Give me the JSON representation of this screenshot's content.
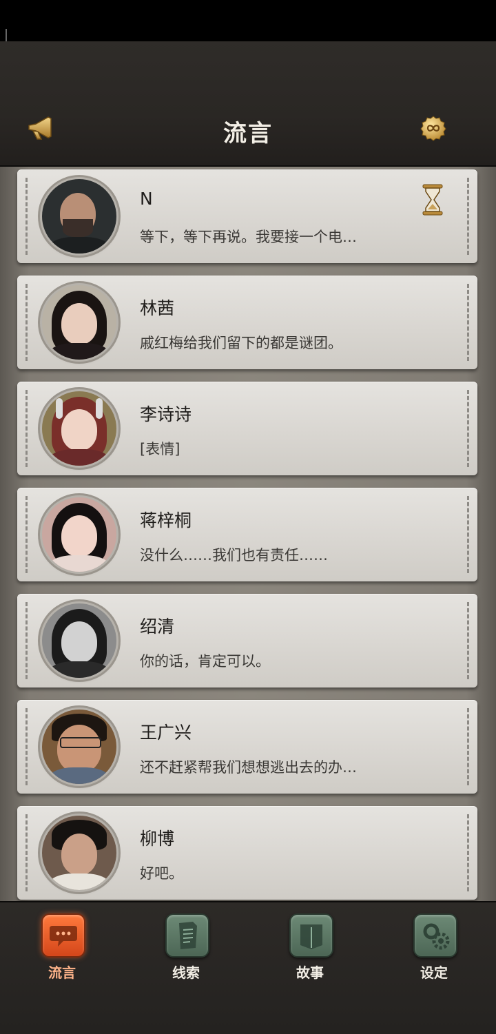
{
  "header": {
    "title": "流言",
    "left_icon": "megaphone-icon",
    "right_icon": "infinity-badge-icon"
  },
  "contacts": [
    {
      "name": "N",
      "message": "等下，等下再说。我要接一个电…",
      "pending_icon": "hourglass-icon"
    },
    {
      "name": "林茜",
      "message": "戚红梅给我们留下的都是谜团。"
    },
    {
      "name": "李诗诗",
      "message": "[表情]"
    },
    {
      "name": "蒋梓桐",
      "message": "没什么……我们也有责任……"
    },
    {
      "name": "绍清",
      "message": "你的话，肯定可以。"
    },
    {
      "name": "王广兴",
      "message": "还不赶紧帮我们想想逃出去的办…"
    },
    {
      "name": "柳博",
      "message": "好吧。"
    }
  ],
  "tabs": [
    {
      "label": "流言",
      "icon": "chat-bubble-icon",
      "active": true
    },
    {
      "label": "线索",
      "icon": "document-icon",
      "active": false
    },
    {
      "label": "故事",
      "icon": "book-icon",
      "active": false
    },
    {
      "label": "设定",
      "icon": "gears-icon",
      "active": false
    }
  ],
  "colors": {
    "active_tab": "#e85a22",
    "inactive_tab": "#5b7865",
    "card": "#dcd9d4",
    "header_bg": "#2a2724"
  }
}
